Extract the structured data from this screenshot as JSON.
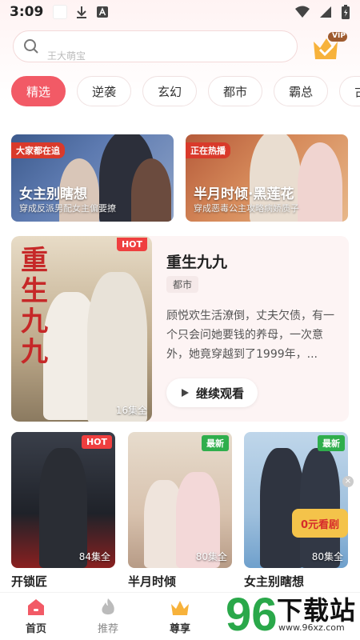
{
  "status_bar": {
    "time": "3:09"
  },
  "search": {
    "placeholder": "王大萌宝"
  },
  "vip": {
    "label": "VIP"
  },
  "tabs": [
    {
      "label": "精选",
      "active": true
    },
    {
      "label": "逆袭"
    },
    {
      "label": "玄幻"
    },
    {
      "label": "都市"
    },
    {
      "label": "霸总"
    },
    {
      "label": "古"
    }
  ],
  "banners": [
    {
      "tag": "大家都在追",
      "title": "女主别瞎想",
      "subtitle": "穿成反派男配女主偏要撩"
    },
    {
      "tag": "正在热播",
      "title": "半月时倾·黑莲花",
      "subtitle": "穿成恶毒公主攻略病娇质子"
    }
  ],
  "featured": {
    "hot": "HOT",
    "poster_calligraphy": "重生九九",
    "episodes": "16集全",
    "title": "重生九九",
    "genre": "都市",
    "description": "顾悦欢生活潦倒，丈夫欠债，有一个只会问她要钱的养母，一次意外，她竟穿越到了1999年，...",
    "continue_label": "继续观看"
  },
  "cards": [
    {
      "tag": "HOT",
      "episodes": "84集全",
      "title": "开锁匠",
      "tag_color": "#ef3f3f"
    },
    {
      "tag": "最新",
      "episodes": "80集全",
      "title": "半月时倾",
      "tag_color": "#2fae4c"
    },
    {
      "tag": "最新",
      "episodes": "80集全",
      "title": "女主别瞎想",
      "tag_color": "#2fae4c",
      "promo": "0元看剧"
    }
  ],
  "bottom_nav": [
    {
      "label": "首页",
      "active": true
    },
    {
      "label": "推荐"
    },
    {
      "label": "尊享",
      "active": true
    }
  ],
  "watermark": {
    "number": "96",
    "text": "下载站",
    "url": "www.96xz.com"
  },
  "colors": {
    "accent": "#f25a66",
    "hot": "#ef3f3f",
    "new": "#2fae4c"
  }
}
